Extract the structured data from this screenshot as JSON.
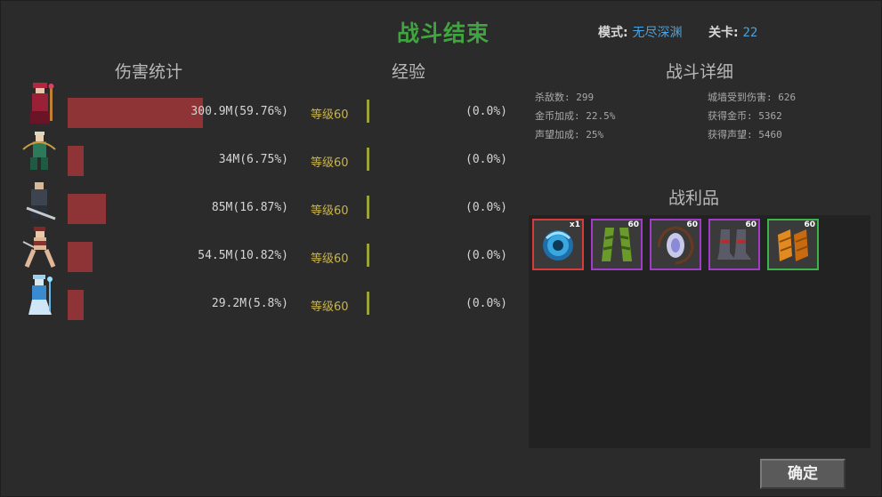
{
  "header": {
    "title": "战斗结束",
    "mode_label": "模式:",
    "mode_value": "无尽深渊",
    "stage_label": "关卡:",
    "stage_value": "22"
  },
  "sections": {
    "damage": "伤害统计",
    "exp": "经验",
    "detail": "战斗详细",
    "loot": "战利品"
  },
  "heroes": [
    {
      "icon": "red-sorceress-avatar",
      "damage": "300.9M(59.76%)",
      "damage_share": 0.5976,
      "level": "等级60",
      "exp": "(0.0%)"
    },
    {
      "icon": "green-archer-avatar",
      "damage": "34M(6.75%)",
      "damage_share": 0.0675,
      "level": "等级60",
      "exp": "(0.0%)"
    },
    {
      "icon": "armored-swordsman-avatar",
      "damage": "85M(16.87%)",
      "damage_share": 0.1687,
      "level": "等级60",
      "exp": "(0.0%)"
    },
    {
      "icon": "female-warrior-avatar",
      "damage": "54.5M(10.82%)",
      "damage_share": 0.1082,
      "level": "等级60",
      "exp": "(0.0%)"
    },
    {
      "icon": "blue-mage-avatar",
      "damage": "29.2M(5.8%)",
      "damage_share": 0.058,
      "level": "等级60",
      "exp": "(0.0%)"
    }
  ],
  "details": {
    "kills_label": "杀敌数:",
    "kills": "299",
    "wall_damage_label": "城墙受到伤害:",
    "wall_damage": "626",
    "gold_bonus_label": "金币加成:",
    "gold_bonus": "22.5%",
    "gold_gain_label": "获得金币:",
    "gold_gain": "5362",
    "fame_bonus_label": "声望加成:",
    "fame_bonus": "25%",
    "fame_gain_label": "获得声望:",
    "fame_gain": "5460"
  },
  "loot": [
    {
      "icon": "blue-orb-icon",
      "badge": "x1",
      "rarity_color": "#d93a3a"
    },
    {
      "icon": "green-leggings-icon",
      "badge": "60",
      "rarity_color": "#a03cc8"
    },
    {
      "icon": "crystal-amulet-icon",
      "badge": "60",
      "rarity_color": "#a03cc8"
    },
    {
      "icon": "iron-boots-icon",
      "badge": "60",
      "rarity_color": "#a03cc8"
    },
    {
      "icon": "orange-bracers-icon",
      "badge": "60",
      "rarity_color": "#3cb44a"
    }
  ],
  "confirm_label": "确定",
  "colors": {
    "title": "#3fa53f",
    "accent_blue": "#4aa3df",
    "damage_bar": "#8e3436",
    "level_text": "#c9b44a"
  }
}
